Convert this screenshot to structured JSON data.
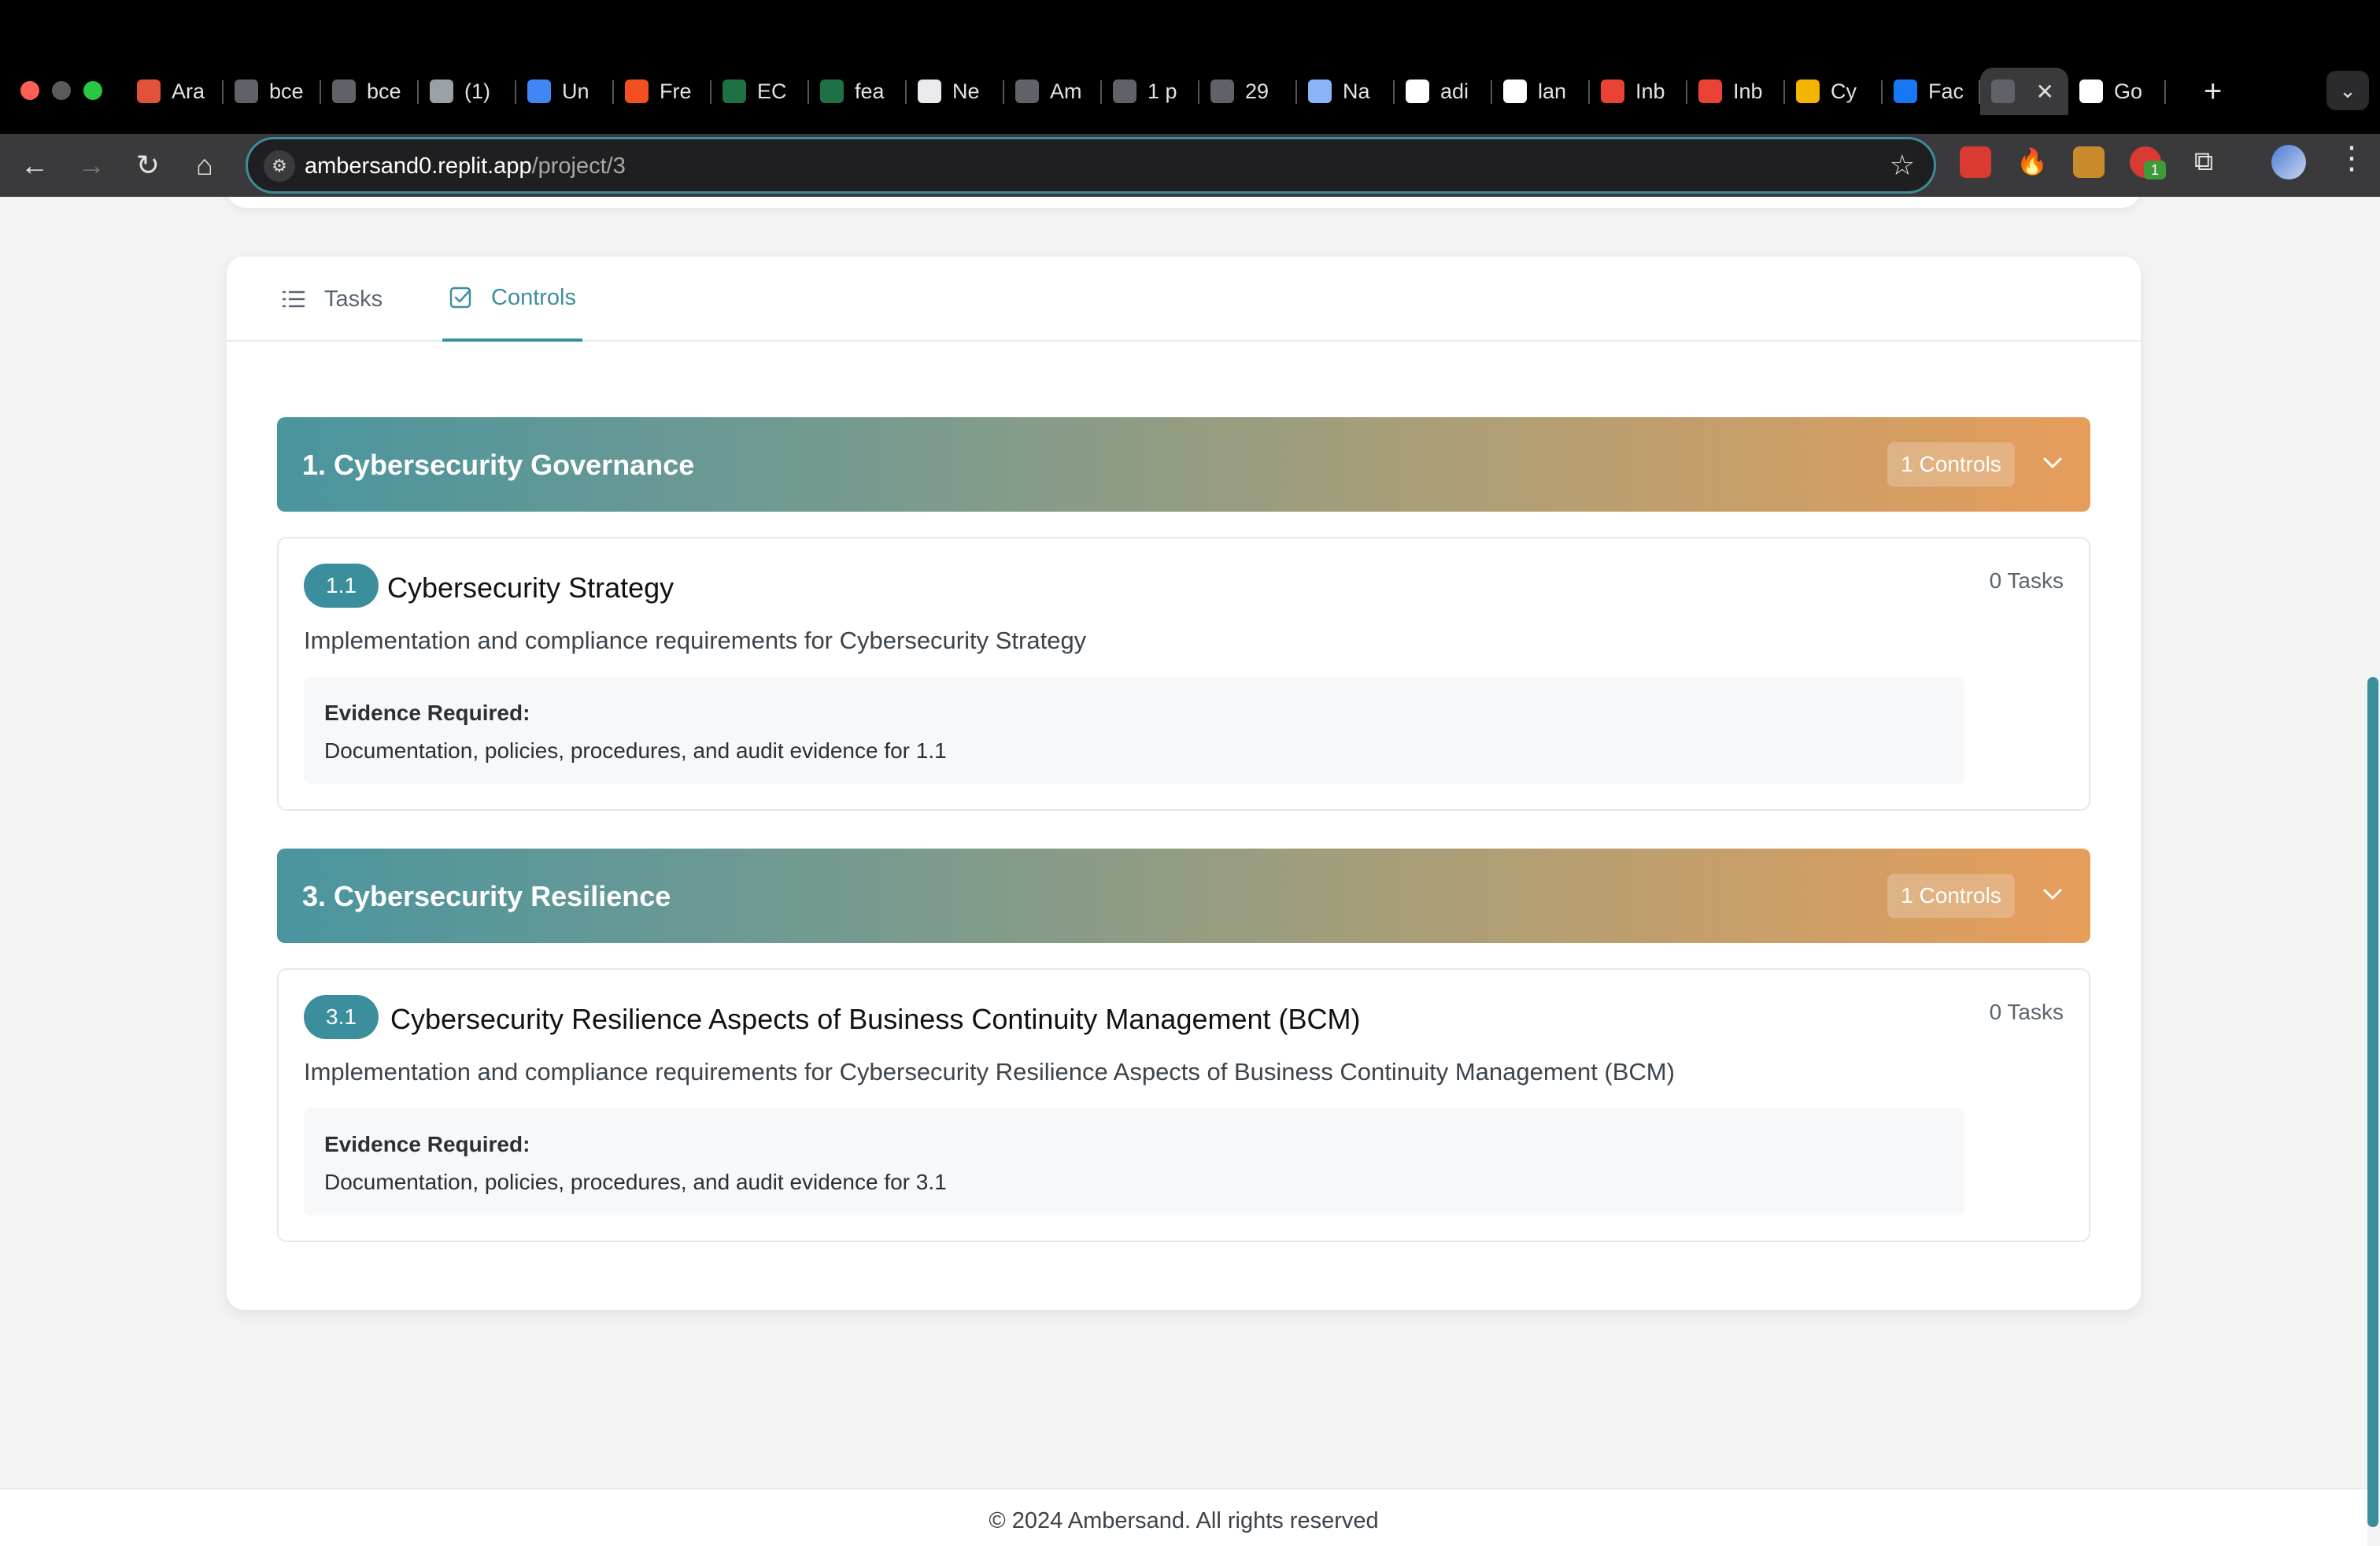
{
  "browser": {
    "tabs": [
      {
        "label": "Ara",
        "favicon_color": "#e0523b"
      },
      {
        "label": "bce",
        "favicon_color": "#5f6368"
      },
      {
        "label": "bce",
        "favicon_color": "#5f6368"
      },
      {
        "label": "(1)",
        "favicon_color": "#9aa0a6"
      },
      {
        "label": "Un",
        "favicon_color": "#4285f4"
      },
      {
        "label": "Fre",
        "favicon_color": "#f25022"
      },
      {
        "label": "EC",
        "favicon_color": "#1e7145"
      },
      {
        "label": "fea",
        "favicon_color": "#1e7145"
      },
      {
        "label": "Ne",
        "favicon_color": "#e8eaed"
      },
      {
        "label": "Am",
        "favicon_color": "#5f6368"
      },
      {
        "label": "1 p",
        "favicon_color": "#5f6368"
      },
      {
        "label": "29",
        "favicon_color": "#5f6368"
      },
      {
        "label": "Na",
        "favicon_color": "#8ab4f8"
      },
      {
        "label": "adi",
        "favicon_color": "#ffffff"
      },
      {
        "label": "lan",
        "favicon_color": "#ffffff"
      },
      {
        "label": "Inb",
        "favicon_color": "#ea4335"
      },
      {
        "label": "Inb",
        "favicon_color": "#ea4335"
      },
      {
        "label": "Cy",
        "favicon_color": "#f4b400"
      },
      {
        "label": "Fac",
        "favicon_color": "#1877f2"
      },
      {
        "label": "",
        "favicon_color": "#5f6368",
        "active": true
      },
      {
        "label": "Go",
        "favicon_color": "#ffffff"
      }
    ],
    "url_host": "ambersand0.replit.app",
    "url_path": "/project/3",
    "extension_badge": "1"
  },
  "page_tabs": [
    {
      "label": "Tasks",
      "icon": "list-icon",
      "active": false
    },
    {
      "label": "Controls",
      "icon": "checkbox-icon",
      "active": true
    }
  ],
  "sections": [
    {
      "title": "1. Cybersecurity Governance",
      "count": "1 Controls",
      "controls": [
        {
          "id": "1.1",
          "title": "Cybersecurity Strategy",
          "tasks": "0 Tasks",
          "description": "Implementation and compliance requirements for Cybersecurity Strategy",
          "evidence_label": "Evidence Required:",
          "evidence_text": "Documentation, policies, procedures, and audit evidence for 1.1"
        }
      ]
    },
    {
      "title": "3. Cybersecurity Resilience",
      "count": "1 Controls",
      "controls": [
        {
          "id": "3.1",
          "title": "Cybersecurity Resilience Aspects of Business Continuity Management (BCM)",
          "tasks": "0 Tasks",
          "description": "Implementation and compliance requirements for Cybersecurity Resilience Aspects of Business Continuity Management (BCM)",
          "evidence_label": "Evidence Required:",
          "evidence_text": "Documentation, policies, procedures, and audit evidence for 3.1"
        }
      ]
    }
  ],
  "footer": {
    "text": "© 2024 Ambersand. All rights reserved"
  },
  "colors": {
    "accent": "#3b8f9c",
    "gradient_start": "#4a959f",
    "gradient_end": "#e79d5a"
  }
}
